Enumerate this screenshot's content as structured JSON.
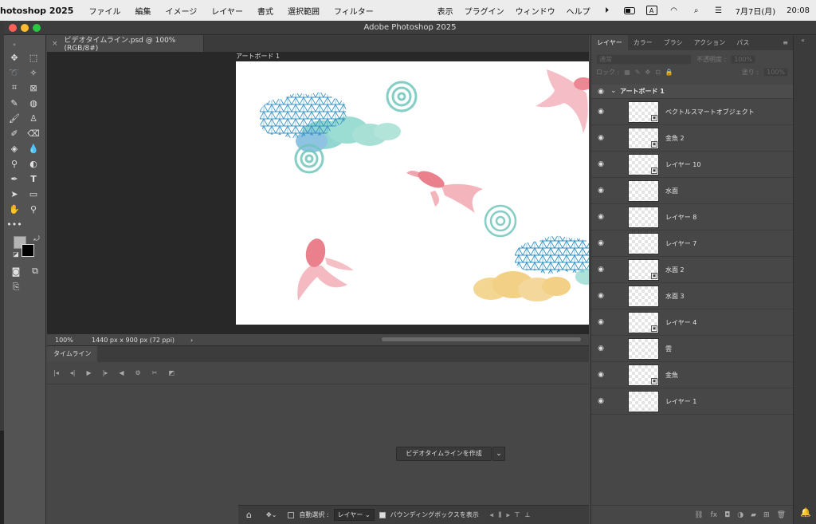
{
  "menubar": {
    "app": "hotoshop 2025",
    "items": [
      "ファイル",
      "編集",
      "イメージ",
      "レイヤー",
      "書式",
      "選択範囲",
      "フィルター"
    ],
    "right_items": [
      "表示",
      "プラグイン",
      "ウィンドウ",
      "ヘルプ"
    ],
    "date": "7月7日(月)",
    "time": "20:08"
  },
  "window": {
    "title": "Adobe Photoshop 2025"
  },
  "document": {
    "tab": "ビデオタイムライン.psd @ 100% (RGB/8#)",
    "artboard_label": "アートボード 1",
    "zoom": "100%",
    "size_info": "1440 px x 900 px (72 ppi)"
  },
  "timeline": {
    "tab": "タイムライン",
    "create_button": "ビデオタイムラインを作成"
  },
  "options_bar": {
    "auto_select": "自動選択 :",
    "layer_select": "レイヤー",
    "bounding_box": "バウンディングボックスを表示"
  },
  "panels": {
    "tabs": [
      "レイヤー",
      "カラー",
      "ブラシ",
      "アクション",
      "パス"
    ],
    "blend_mode": "通常",
    "opacity_label": "不透明度 :",
    "opacity_value": "100%",
    "lock_label": "ロック :",
    "fill_label": "塗り :",
    "fill_value": "100%"
  },
  "layers": {
    "group": "アートボード 1",
    "items": [
      {
        "name": "ベクトルスマートオブジェクト"
      },
      {
        "name": "金魚 2"
      },
      {
        "name": "レイヤー 10"
      },
      {
        "name": "水面"
      },
      {
        "name": "レイヤー 8"
      },
      {
        "name": "レイヤー 7"
      },
      {
        "name": "水面 2"
      },
      {
        "name": "水面 3"
      },
      {
        "name": "レイヤー 4"
      },
      {
        "name": "雲"
      },
      {
        "name": "金魚"
      },
      {
        "name": "レイヤー 1"
      }
    ]
  },
  "colors": {
    "accent": "#4a90d9",
    "goldfish": "#e86a7a",
    "cloud_blue": "#3a96c8",
    "cloud_teal": "#7fd0c8",
    "cloud_yellow": "#f0c870"
  }
}
